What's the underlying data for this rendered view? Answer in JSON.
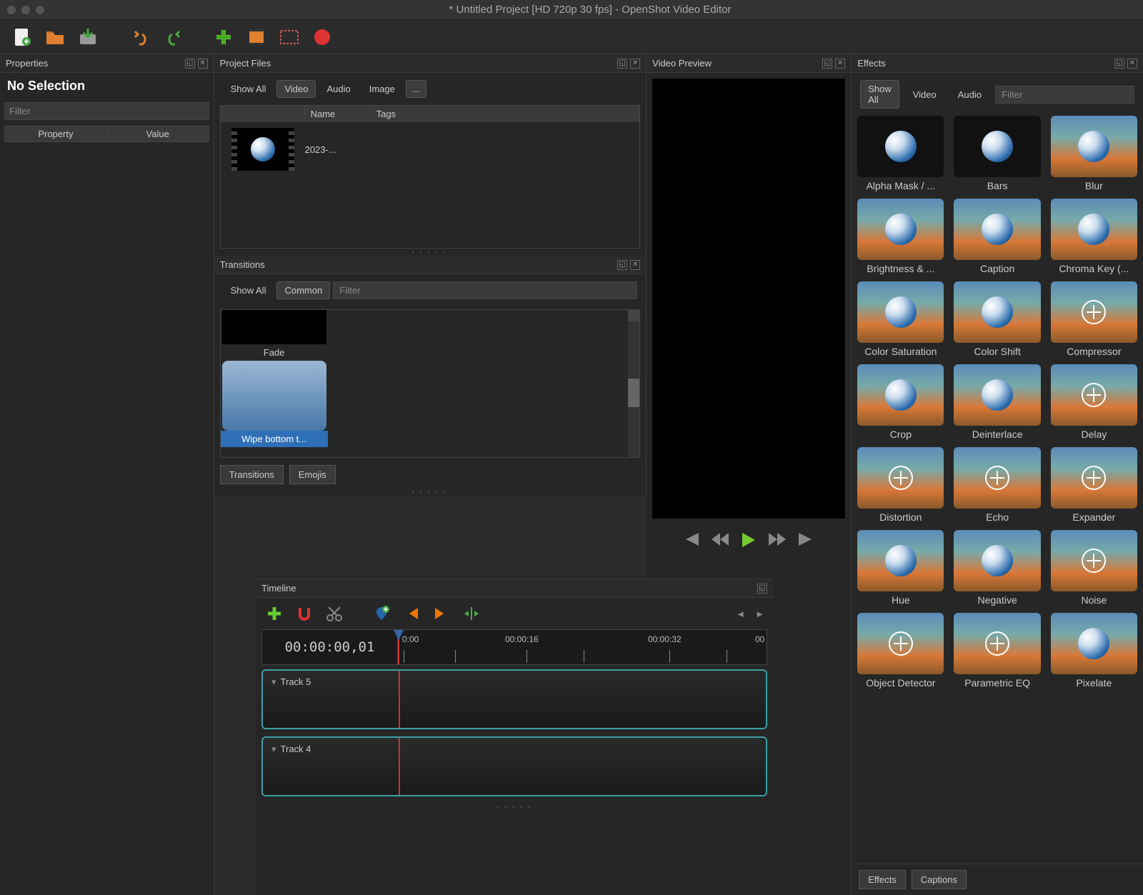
{
  "title": "* Untitled Project [HD 720p 30 fps] - OpenShot Video Editor",
  "panels": {
    "properties": {
      "title": "Properties",
      "nosel": "No Selection",
      "filter_ph": "Filter",
      "col1": "Property",
      "col2": "Value"
    },
    "projectfiles": {
      "title": "Project Files",
      "tabs": {
        "all": "Show All",
        "video": "Video",
        "audio": "Audio",
        "image": "Image",
        "more": "..."
      },
      "cols": {
        "name": "Name",
        "tags": "Tags"
      },
      "file1": "2023-..."
    },
    "transitions": {
      "title": "Transitions",
      "tabs": {
        "all": "Show All",
        "common": "Common"
      },
      "filter_ph": "Filter",
      "item1": "Fade",
      "item2": "Wipe bottom t...",
      "bottom": {
        "trans": "Transitions",
        "emoji": "Emojis"
      }
    },
    "timeline": {
      "title": "Timeline",
      "tc": "00:00:00,01",
      "m0": "0:00",
      "m1": "00:00:16",
      "m2": "00:00:32",
      "m3": "00",
      "track5": "Track 5",
      "track4": "Track 4"
    },
    "preview": {
      "title": "Video Preview"
    },
    "effects": {
      "title": "Effects",
      "tabs": {
        "all": "Show All",
        "video": "Video",
        "audio": "Audio"
      },
      "filter_ph": "Filter",
      "items": [
        "Alpha Mask / ...",
        "Bars",
        "Blur",
        "Brightness & ...",
        "Caption",
        "Chroma Key (...",
        "Color Saturation",
        "Color Shift",
        "Compressor",
        "Crop",
        "Deinterlace",
        "Delay",
        "Distortion",
        "Echo",
        "Expander",
        "Hue",
        "Negative",
        "Noise",
        "Object Detector",
        "Parametric EQ",
        "Pixelate"
      ],
      "bottom": {
        "fx": "Effects",
        "cap": "Captions"
      }
    }
  }
}
